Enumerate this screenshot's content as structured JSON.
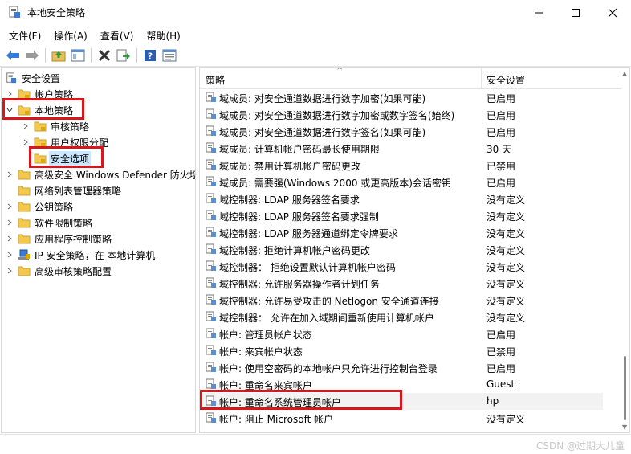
{
  "window": {
    "title": "本地安全策略"
  },
  "menu": [
    "文件(F)",
    "操作(A)",
    "查看(V)",
    "帮助(H)"
  ],
  "toolbar_icons": [
    "back-arrow-icon",
    "forward-arrow-icon",
    "up-folder-icon",
    "show-hide-tree-icon",
    "delete-icon",
    "export-list-icon",
    "help-icon",
    "properties-icon"
  ],
  "tree": {
    "root": "安全设置",
    "items": [
      {
        "label": "帐户策略"
      },
      {
        "label": "本地策略"
      },
      {
        "label": "审核策略"
      },
      {
        "label": "用户权限分配"
      },
      {
        "label": "安全选项"
      },
      {
        "label": "高级安全 Windows Defender 防火墙"
      },
      {
        "label": "网络列表管理器策略"
      },
      {
        "label": "公钥策略"
      },
      {
        "label": "软件限制策略"
      },
      {
        "label": "应用程序控制策略"
      },
      {
        "label": "IP 安全策略，在 本地计算机"
      },
      {
        "label": "高级审核策略配置"
      }
    ]
  },
  "list": {
    "columns": {
      "policy": "策略",
      "setting": "安全设置"
    },
    "rows": [
      {
        "policy": "域成员: 对安全通道数据进行数字加密(如果可能)",
        "setting": "已启用"
      },
      {
        "policy": "域成员: 对安全通道数据进行数字加密或数字签名(始终)",
        "setting": "已启用"
      },
      {
        "policy": "域成员: 对安全通道数据进行数字签名(如果可能)",
        "setting": "已启用"
      },
      {
        "policy": "域成员: 计算机帐户密码最长使用期限",
        "setting": "30 天"
      },
      {
        "policy": "域成员: 禁用计算机帐户密码更改",
        "setting": "已禁用"
      },
      {
        "policy": "域成员: 需要强(Windows 2000 或更高版本)会话密钥",
        "setting": "已启用"
      },
      {
        "policy": "域控制器: LDAP 服务器签名要求",
        "setting": "没有定义"
      },
      {
        "policy": "域控制器: LDAP 服务器签名要求强制",
        "setting": "没有定义"
      },
      {
        "policy": "域控制器: LDAP 服务器通道绑定令牌要求",
        "setting": "没有定义"
      },
      {
        "policy": "域控制器: 拒绝计算机帐户密码更改",
        "setting": "没有定义"
      },
      {
        "policy": "域控制器： 拒绝设置默认计算机帐户密码",
        "setting": "没有定义"
      },
      {
        "policy": "域控制器: 允许服务器操作者计划任务",
        "setting": "没有定义"
      },
      {
        "policy": "域控制器: 允许易受攻击的 Netlogon 安全通道连接",
        "setting": "没有定义"
      },
      {
        "policy": "域控制器： 允许在加入域期间重新使用计算机帐户",
        "setting": "没有定义"
      },
      {
        "policy": "帐户: 管理员帐户状态",
        "setting": "已启用"
      },
      {
        "policy": "帐户: 来宾帐户状态",
        "setting": "已禁用"
      },
      {
        "policy": "帐户: 使用空密码的本地帐户只允许进行控制台登录",
        "setting": "已启用"
      },
      {
        "policy": "帐户: 重命名来宾帐户",
        "setting": "Guest"
      },
      {
        "policy": "帐户: 重命名系统管理员帐户",
        "setting": "hp"
      },
      {
        "policy": "帐户: 阻止 Microsoft 帐户",
        "setting": "没有定义"
      }
    ]
  },
  "watermark": "CSDN @过期大儿童",
  "colors": {
    "annotation_red": "#d9161c",
    "selection_blue": "#cce8ff",
    "folder_yellow": "#f2c94c"
  }
}
